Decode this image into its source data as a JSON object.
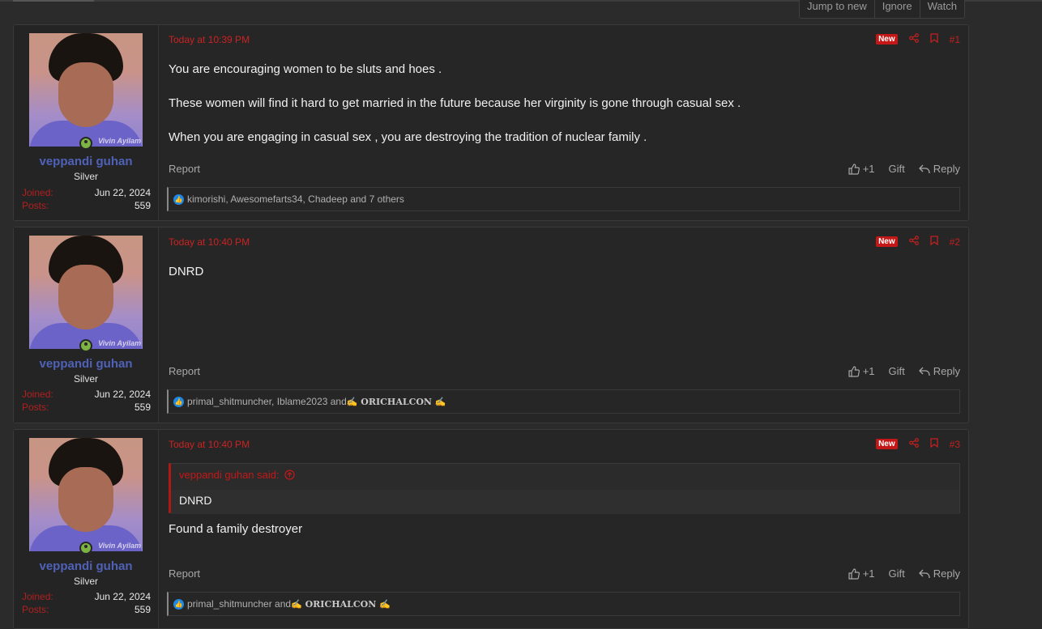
{
  "thread_nav": {
    "jump_to_new": "Jump to new",
    "ignore": "Ignore",
    "watch": "Watch"
  },
  "posts": [
    {
      "author": "veppandi guhan",
      "user_title": "Silver",
      "joined_label": "Joined:",
      "joined": "Jun 22, 2024",
      "posts_label": "Posts:",
      "posts": "559",
      "avatar_watermark": "Vivin Ayilam",
      "date": "Today at 10:39 PM",
      "new_badge": "New",
      "number": "#1",
      "paragraphs": [
        "You are encouraging women to be sluts and hoes .",
        "These women will find it hard to get married in the future because her virginity is gone through casual sex .",
        "When you are engaging in casual sex , you are destroying the tradition of nuclear family ."
      ],
      "report": "Report",
      "like": "+1",
      "gift": "Gift",
      "reply": "Reply",
      "reactions": "kimorishi, Awesomefarts34, Chadeep and 7 others"
    },
    {
      "author": "veppandi guhan",
      "user_title": "Silver",
      "joined_label": "Joined:",
      "joined": "Jun 22, 2024",
      "posts_label": "Posts:",
      "posts": "559",
      "avatar_watermark": "Vivin Ayilam",
      "date": "Today at 10:40 PM",
      "new_badge": "New",
      "number": "#2",
      "paragraphs": [
        "DNRD"
      ],
      "report": "Report",
      "like": "+1",
      "gift": "Gift",
      "reply": "Reply",
      "reactions_prefix": "primal_shitmuncher, Iblame2023 and ",
      "reactions_bold": "✍ ORICHALCON ✍"
    },
    {
      "author": "veppandi guhan",
      "user_title": "Silver",
      "joined_label": "Joined:",
      "joined": "Jun 22, 2024",
      "posts_label": "Posts:",
      "posts": "559",
      "avatar_watermark": "Vivin Ayilam",
      "date": "Today at 10:40 PM",
      "new_badge": "New",
      "number": "#3",
      "quote_author": "veppandi guhan said:",
      "quote_text": "DNRD",
      "paragraphs": [
        "Found a family destroyer"
      ],
      "report": "Report",
      "like": "+1",
      "gift": "Gift",
      "reply": "Reply",
      "reactions_prefix": "primal_shitmuncher and ",
      "reactions_bold": "✍ ORICHALCON ✍"
    }
  ],
  "colors": {
    "accent_red": "#c41818",
    "username_blue": "#4f62b8",
    "like_blue": "#1e88e5",
    "online_green": "#7cb342"
  }
}
